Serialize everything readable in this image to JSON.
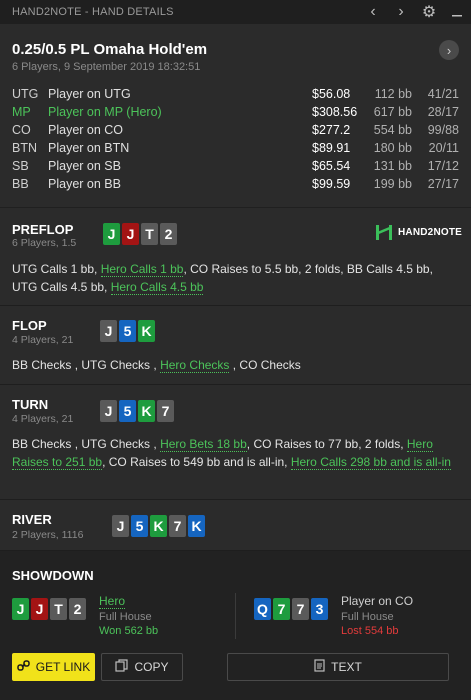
{
  "window": {
    "title": "HAND2NOTE - HAND DETAILS"
  },
  "hand": {
    "title": "0.25/0.5 PL Omaha Hold'em",
    "subtitle": "6 Players, 9 September 2019 18:32:51",
    "players": [
      {
        "pos": "UTG",
        "name": "Player on UTG",
        "stack": "$56.08",
        "bb": "112 bb",
        "ratio": "41/21",
        "hero": false
      },
      {
        "pos": "MP",
        "name": "Player on MP (Hero)",
        "stack": "$308.56",
        "bb": "617 bb",
        "ratio": "28/17",
        "hero": true
      },
      {
        "pos": "CO",
        "name": "Player on CO",
        "stack": "$277.2",
        "bb": "554 bb",
        "ratio": "99/88",
        "hero": false
      },
      {
        "pos": "BTN",
        "name": "Player on BTN",
        "stack": "$89.91",
        "bb": "180 bb",
        "ratio": "20/11",
        "hero": false
      },
      {
        "pos": "SB",
        "name": "Player on SB",
        "stack": "$65.54",
        "bb": "131 bb",
        "ratio": "17/12",
        "hero": false
      },
      {
        "pos": "BB",
        "name": "Player on BB",
        "stack": "$99.59",
        "bb": "199 bb",
        "ratio": "27/17",
        "hero": false
      }
    ]
  },
  "logo": {
    "text": "HAND2NOTE",
    "color": "#3bbf5a"
  },
  "streets": [
    {
      "name": "PREFLOP",
      "sub": "6 Players, 1.5",
      "cards": [
        {
          "rank": "J",
          "suit": "c"
        },
        {
          "rank": "J",
          "suit": "h"
        },
        {
          "rank": "T",
          "suit": "s"
        },
        {
          "rank": "2",
          "suit": "s"
        }
      ],
      "actions": [
        {
          "t": "UTG ",
          "h": false
        },
        {
          "t": "Calls 1 bb",
          "h": false
        },
        {
          "t": ", ",
          "h": false
        },
        {
          "t": "Hero Calls 1 bb",
          "h": true
        },
        {
          "t": ", CO ",
          "h": false
        },
        {
          "t": "Raises to 5.5 bb",
          "h": false
        },
        {
          "t": ", 2 folds, BB ",
          "h": false
        },
        {
          "t": "Calls 4.5 bb",
          "h": false
        },
        {
          "t": ", UTG ",
          "h": false
        },
        {
          "t": "Calls 4.5 bb",
          "h": false
        },
        {
          "t": ", ",
          "h": false
        },
        {
          "t": "Hero Calls 4.5 bb",
          "h": true
        }
      ]
    },
    {
      "name": "FLOP",
      "sub": "4 Players, 21",
      "cards": [
        {
          "rank": "J",
          "suit": "s"
        },
        {
          "rank": "5",
          "suit": "d"
        },
        {
          "rank": "K",
          "suit": "c"
        }
      ],
      "actions": [
        {
          "t": "BB ",
          "h": false
        },
        {
          "t": "Checks",
          "h": false
        },
        {
          "t": " , UTG ",
          "h": false
        },
        {
          "t": "Checks",
          "h": false
        },
        {
          "t": " , ",
          "h": false
        },
        {
          "t": "Hero Checks",
          "h": true
        },
        {
          "t": " , CO ",
          "h": false
        },
        {
          "t": "Checks",
          "h": false
        }
      ]
    },
    {
      "name": "TURN",
      "sub": "4 Players, 21",
      "cards": [
        {
          "rank": "J",
          "suit": "s"
        },
        {
          "rank": "5",
          "suit": "d"
        },
        {
          "rank": "K",
          "suit": "c"
        },
        {
          "rank": "7",
          "suit": "s"
        }
      ],
      "actions": [
        {
          "t": "BB ",
          "h": false
        },
        {
          "t": "Checks",
          "h": false
        },
        {
          "t": " , UTG ",
          "h": false
        },
        {
          "t": "Checks",
          "h": false
        },
        {
          "t": " , ",
          "h": false
        },
        {
          "t": "Hero Bets 18 bb",
          "h": true
        },
        {
          "t": ", CO ",
          "h": false
        },
        {
          "t": "Raises to 77 bb",
          "h": false
        },
        {
          "t": ", 2 folds, ",
          "h": false
        },
        {
          "t": "Hero Raises to 251 bb",
          "h": true
        },
        {
          "t": ", CO ",
          "h": false
        },
        {
          "t": "Raises to 549 bb and is all-in",
          "h": false
        },
        {
          "t": ", ",
          "h": false
        },
        {
          "t": "Hero Calls 298 bb and is all-in",
          "h": true
        }
      ]
    },
    {
      "name": "RIVER",
      "sub": "2 Players, 1116",
      "cards": [
        {
          "rank": "J",
          "suit": "s"
        },
        {
          "rank": "5",
          "suit": "d"
        },
        {
          "rank": "K",
          "suit": "c"
        },
        {
          "rank": "7",
          "suit": "s"
        },
        {
          "rank": "K",
          "suit": "d"
        }
      ],
      "actions": []
    }
  ],
  "showdown": {
    "title": "SHOWDOWN",
    "hero": {
      "name": "Hero",
      "hand": "Full House",
      "result": "Won 562 bb",
      "cards": [
        {
          "rank": "J",
          "suit": "c"
        },
        {
          "rank": "J",
          "suit": "h"
        },
        {
          "rank": "T",
          "suit": "s"
        },
        {
          "rank": "2",
          "suit": "s"
        }
      ]
    },
    "villain": {
      "name": "Player on CO",
      "hand": "Full House",
      "result": "Lost 554 bb",
      "cards": [
        {
          "rank": "Q",
          "suit": "d"
        },
        {
          "rank": "7",
          "suit": "c"
        },
        {
          "rank": "7",
          "suit": "s"
        },
        {
          "rank": "3",
          "suit": "d"
        }
      ]
    }
  },
  "buttons": {
    "get_link": "GET LINK",
    "copy": "COPY",
    "text": "TEXT"
  },
  "colors": {
    "hero": "#4cc35a",
    "won": "#4cc35a",
    "lost": "#e23b3b",
    "accent": "#f1e21a"
  }
}
